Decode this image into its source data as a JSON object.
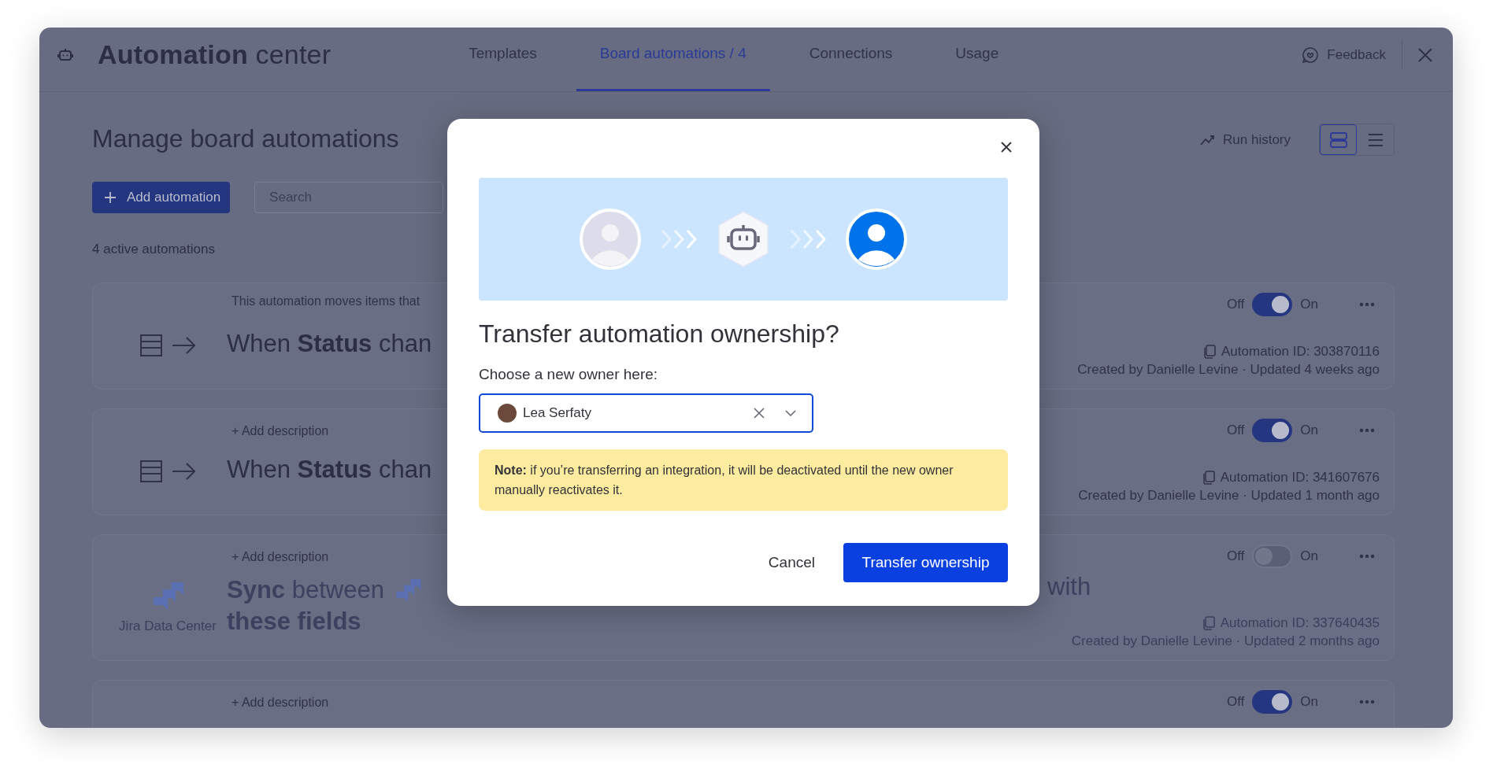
{
  "header": {
    "title": "**Automation** center",
    "tabs": [
      {
        "label": "Templates",
        "selected": false
      },
      {
        "label": "Board automations / 4",
        "selected": true
      },
      {
        "label": "Connections",
        "selected": false
      },
      {
        "label": "Usage",
        "selected": false
      }
    ],
    "feedback": "Feedback"
  },
  "page": {
    "heading": "Manage board automations",
    "add_button": "Add automation",
    "search": {
      "placeholder": "Search"
    },
    "count": "4 active automations",
    "run_history": "Run history",
    "views": [
      {
        "kind": "cards",
        "selected": true
      },
      {
        "kind": "list",
        "selected": false
      }
    ]
  },
  "automations": [
    {
      "kind": "board",
      "description": "This automation moves items that",
      "title": "When **Status** chan",
      "toggle": {
        "off_label": "Off",
        "on_label": "On",
        "on": true
      },
      "id": "Automation ID: 303870116",
      "meta": "Created by Danielle Levine · Updated 4 weeks ago"
    },
    {
      "kind": "board",
      "add_description": "+ Add description",
      "title": "When **Status** chan",
      "toggle": {
        "off_label": "Off",
        "on_label": "On",
        "on": true
      },
      "id": "Automation ID: 341607676",
      "meta": "Created by Danielle Levine · Updated 1 month ago"
    },
    {
      "kind": "integration",
      "add_description": "+ Add description",
      "app": "Jira Data Center",
      "title": "**Sync** between",
      "title_line2": "these fields",
      "trailing": "with",
      "toggle": {
        "off_label": "Off",
        "on_label": "On",
        "on": false
      },
      "id": "Automation ID: 337640435",
      "meta": "Created by Danielle Levine · Updated 2 months ago"
    },
    {
      "kind": "board",
      "add_description": "+ Add description",
      "toggle": {
        "off_label": "Off",
        "on_label": "On",
        "on": true
      }
    }
  ],
  "modal": {
    "title": "Transfer automation ownership?",
    "label": "Choose a new owner here:",
    "owner": {
      "name": "Lea Serfaty"
    },
    "note": "**Note:** if you’re transferring an integration, it will be deactivated until the new owner manually reactivates it.",
    "buttons": [
      {
        "kind": "secondary",
        "label": "Cancel"
      },
      {
        "kind": "primary",
        "label": "Transfer ownership"
      }
    ]
  }
}
